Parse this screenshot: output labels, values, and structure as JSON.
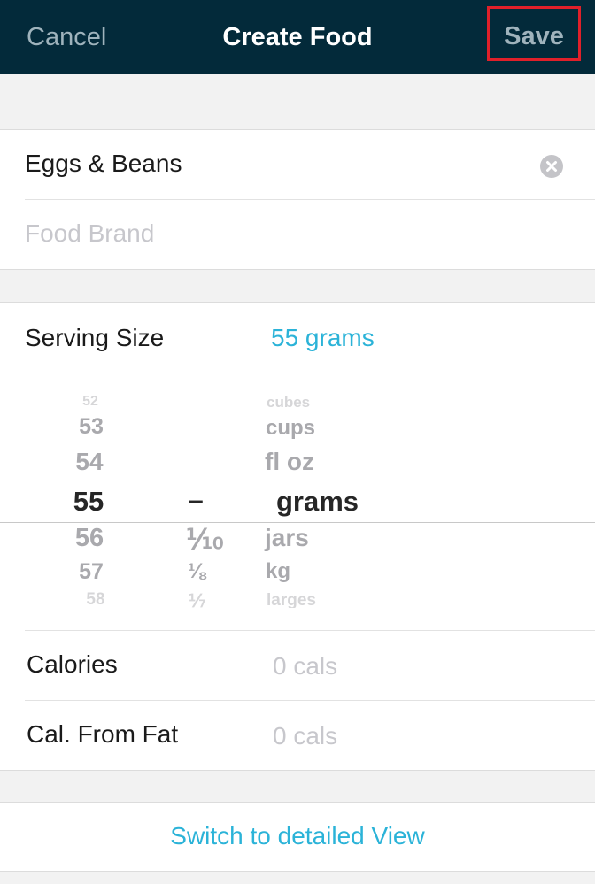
{
  "header": {
    "cancel_label": "Cancel",
    "title": "Create Food",
    "save_label": "Save"
  },
  "food": {
    "name_value": "Eggs & Beans",
    "brand_placeholder": "Food Brand"
  },
  "serving": {
    "label": "Serving Size",
    "value": "55 grams",
    "picker": {
      "numbers": [
        "52",
        "53",
        "54",
        "55",
        "56",
        "57",
        "58"
      ],
      "fractions": [
        "",
        "",
        "",
        "–",
        "⅒",
        "⅛",
        "⅐"
      ],
      "units": [
        "cubes",
        "cups",
        "fl oz",
        "grams",
        "jars",
        "kg",
        "larges"
      ],
      "selected_index": 3
    }
  },
  "nutrition": {
    "calories_label": "Calories",
    "calories_value": "0 cals",
    "fat_label": "Cal. From Fat",
    "fat_value": "0 cals"
  },
  "footer": {
    "switch_label": "Switch to detailed View"
  },
  "colors": {
    "header_bg": "#032a3a",
    "accent": "#2bb3d8",
    "highlight_box": "#e0202a"
  },
  "icons": {
    "clear": "clear-circle-icon"
  }
}
